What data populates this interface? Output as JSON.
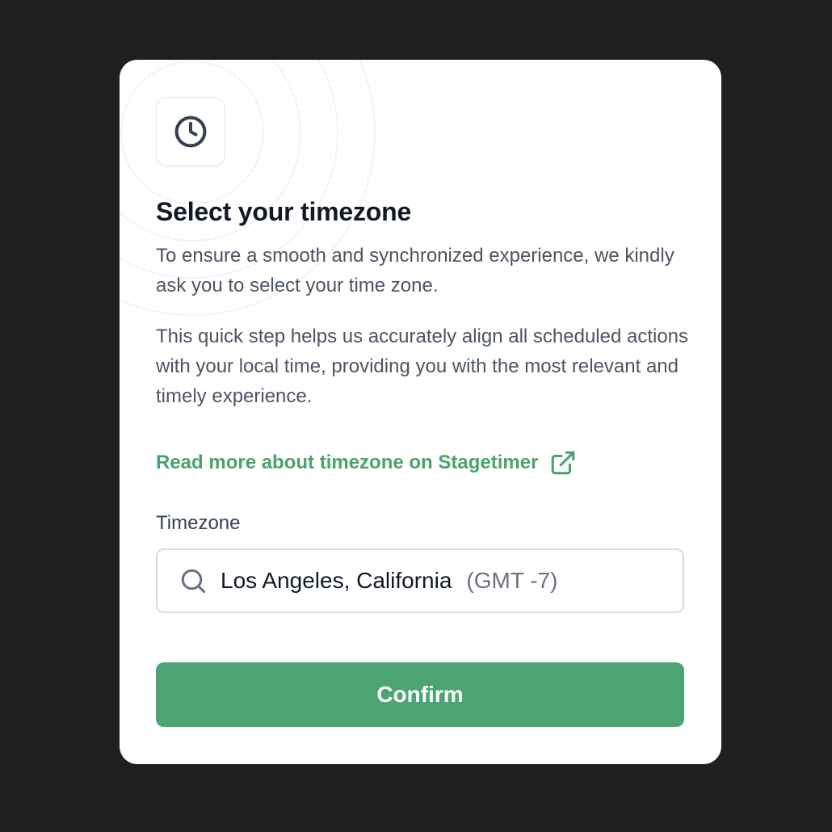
{
  "modal": {
    "header_icon": "clock-icon",
    "title": "Select your timezone",
    "paragraph_1": "To ensure a smooth and synchronized experience, we kindly ask you to select your time zone.",
    "paragraph_2": "This quick step helps us accurately align all scheduled actions with your local time, providing you with the most relevant and timely experience.",
    "link": {
      "label": "Read more about timezone on Stagetimer",
      "icon": "external-link-icon"
    },
    "timezone_field": {
      "label": "Timezone",
      "icon": "search-icon",
      "value": "Los Angeles, California",
      "offset": "(GMT -7)"
    },
    "confirm_label": "Confirm"
  },
  "colors": {
    "page_background": "#1f1f1f",
    "accent_green": "#4ba472",
    "title_text": "#111827",
    "body_text": "#4b5563"
  }
}
